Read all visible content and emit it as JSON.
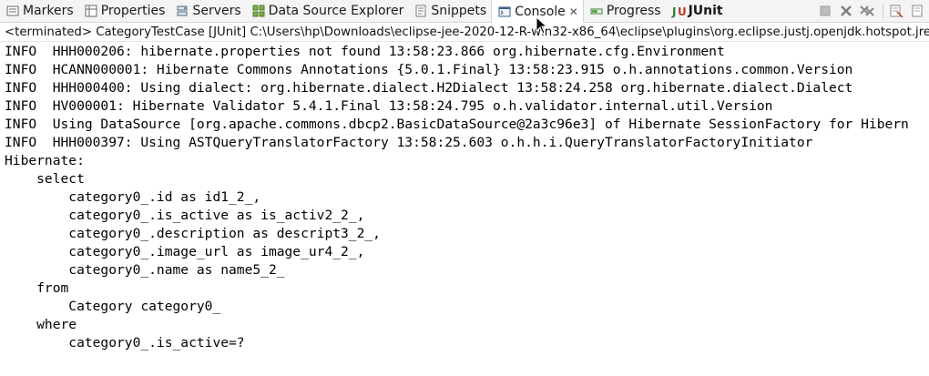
{
  "tabs": [
    {
      "label": "Markers",
      "icon": "markers-icon",
      "active": false
    },
    {
      "label": "Properties",
      "icon": "properties-icon",
      "active": false
    },
    {
      "label": "Servers",
      "icon": "servers-icon",
      "active": false
    },
    {
      "label": "Data Source Explorer",
      "icon": "data-source-explorer-icon",
      "active": false
    },
    {
      "label": "Snippets",
      "icon": "snippets-icon",
      "active": false
    },
    {
      "label": "Console",
      "icon": "console-icon",
      "active": true
    },
    {
      "label": "Progress",
      "icon": "progress-icon",
      "active": false
    },
    {
      "label": "JUnit",
      "icon": "junit-icon",
      "active": false
    }
  ],
  "toolbar": {
    "buttons": [
      "terminate-icon",
      "remove-launch-icon",
      "remove-all-terminated-icon",
      "clear-console-icon",
      "scroll-lock-icon"
    ]
  },
  "status_line": "<terminated> CategoryTestCase [JUnit] C:\\Users\\hp\\Downloads\\eclipse-jee-2020-12-R-win32-x86_64\\eclipse\\plugins\\org.eclipse.justj.openjdk.hotspot.jre.",
  "console_lines": [
    "INFO  HHH000206: hibernate.properties not found 13:58:23.866 org.hibernate.cfg.Environment",
    "INFO  HCANN000001: Hibernate Commons Annotations {5.0.1.Final} 13:58:23.915 o.h.annotations.common.Version",
    "INFO  HHH000400: Using dialect: org.hibernate.dialect.H2Dialect 13:58:24.258 org.hibernate.dialect.Dialect",
    "INFO  HV000001: Hibernate Validator 5.4.1.Final 13:58:24.795 o.h.validator.internal.util.Version",
    "INFO  Using DataSource [org.apache.commons.dbcp2.BasicDataSource@2a3c96e3] of Hibernate SessionFactory for Hibern",
    "INFO  HHH000397: Using ASTQueryTranslatorFactory 13:58:25.603 o.h.h.i.QueryTranslatorFactoryInitiator",
    "Hibernate:",
    "    select",
    "        category0_.id as id1_2_,",
    "        category0_.is_active as is_activ2_2_,",
    "        category0_.description as descript3_2_,",
    "        category0_.image_url as image_ur4_2_,",
    "        category0_.name as name5_2_",
    "    from",
    "        Category category0_",
    "    where",
    "        category0_.is_active=?"
  ],
  "colors": {
    "tab_bar_bg": "#f4f4f4",
    "console_bg": "#ffffff",
    "console_text": "#000000"
  }
}
